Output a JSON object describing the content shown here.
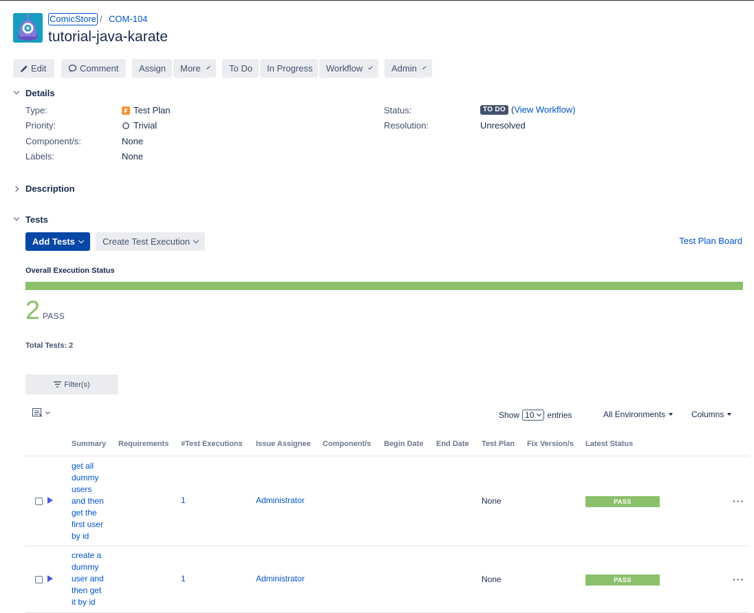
{
  "breadcrumb": {
    "project": "ComicStore",
    "separator": "/",
    "issue_key": "COM-104"
  },
  "title": "tutorial-java-karate",
  "toolbar": {
    "edit": "Edit",
    "comment": "Comment",
    "assign": "Assign",
    "more": "More",
    "todo": "To Do",
    "in_progress": "In Progress",
    "workflow": "Workflow",
    "admin": "Admin"
  },
  "details": {
    "title": "Details",
    "type_label": "Type:",
    "type_value": "Test Plan",
    "priority_label": "Priority:",
    "priority_value": "Trivial",
    "components_label": "Component/s:",
    "components_value": "None",
    "labels_label": "Labels:",
    "labels_value": "None",
    "status_label": "Status:",
    "status_value": "TO DO",
    "view_workflow_open": "(",
    "view_workflow": "View Workflow",
    "view_workflow_close": ")",
    "resolution_label": "Resolution:",
    "resolution_value": "Unresolved"
  },
  "description": {
    "title": "Description"
  },
  "tests": {
    "title": "Tests",
    "add_tests": "Add Tests",
    "create_execution": "Create Test Execution",
    "board_link": "Test Plan Board",
    "overall_title": "Overall Execution Status",
    "pass_count": "2",
    "pass_label": "PASS",
    "pass_fraction": 1.0,
    "total_label": "Total Tests: 2",
    "filter_label": "Filter(s)",
    "show_label": "Show",
    "show_value": "10",
    "entries_label": "entries",
    "environments": "All Environments",
    "columns": "Columns"
  },
  "table": {
    "headers": {
      "summary": "Summary",
      "requirements": "Requirements",
      "executions": "#Test Executions",
      "assignee": "Issue Assignee",
      "components": "Component/s",
      "begin": "Begin Date",
      "end": "End Date",
      "plan": "Test Plan",
      "fix": "Fix Version/s",
      "latest": "Latest Status"
    },
    "rows": [
      {
        "summary_lines": [
          "get all",
          "dummy",
          "users",
          "and then",
          "get the",
          "first user",
          "by id"
        ],
        "executions": "1",
        "assignee": "Administrator",
        "plan": "None",
        "status": "PASS"
      },
      {
        "summary_lines": [
          "create a",
          "dummy",
          "user and",
          "then get",
          "it by id"
        ],
        "executions": "1",
        "assignee": "Administrator",
        "plan": "None",
        "status": "PASS"
      }
    ]
  },
  "colors": {
    "link": "#0052cc",
    "pass": "#8cc06b",
    "primary": "#0747a6"
  }
}
